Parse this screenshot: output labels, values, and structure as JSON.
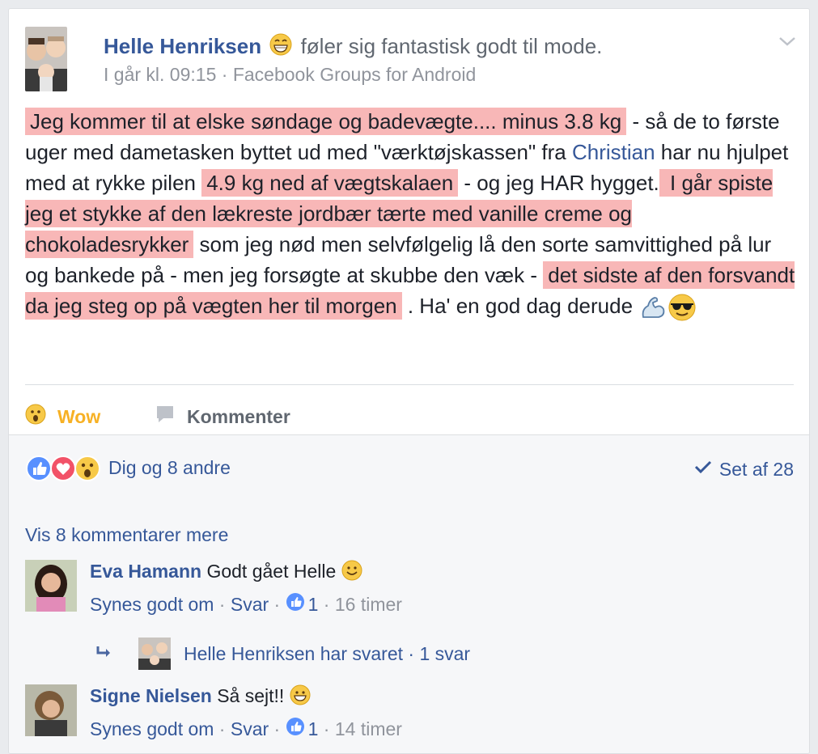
{
  "post": {
    "author": "Helle Henriksen",
    "feeling": "føler sig fantastisk godt til mode.",
    "timestamp": "I går kl. 09:15",
    "separator": " · ",
    "source": "Facebook Groups for Android",
    "body": {
      "hl1": "Jeg kommer til at elske søndage og badevægte....  minus 3.8 kg",
      "t1": " - så de to første uger med dametasken byttet ud med \"værktøjskassen\" fra ",
      "mention": "Christian",
      "t2": " har nu hjulpet med at rykke pilen ",
      "hl2": "4.9 kg ned af vægtskalaen",
      "t3": " - og jeg HAR hygget.",
      "hl3": " I går spiste jeg et stykke af den lækreste jordbær tærte med vanille creme og chokoladesrykker",
      "t4": " som jeg nød men selvfølgelig lå den sorte samvittighed på lur og bankede på - men jeg forsøgte at skubbe den væk - ",
      "hl4": "det sidste af den forsvandt da jeg steg op på vægten her til morgen",
      "t5": " . Ha' en god dag derude "
    }
  },
  "actions": {
    "wow_label": "Wow",
    "comment_label": "Kommenter"
  },
  "feedback": {
    "reactions_text": "Dig og 8 andre",
    "seen_text": "Set af 28",
    "more_comments": "Vis 8 kommentarer mere"
  },
  "comments": [
    {
      "name": "Eva Hamann",
      "text": " Godt gået Helle ",
      "like_label": "Synes godt om",
      "reply_label": "Svar",
      "like_count": "1",
      "time": "16 timer",
      "reply_summary": "Helle Henriksen har svaret · 1 svar"
    },
    {
      "name": "Signe Nielsen",
      "text": " Så sejt!! ",
      "like_label": "Synes godt om",
      "reply_label": "Svar",
      "like_count": "1",
      "time": "14 timer"
    }
  ],
  "colors": {
    "link": "#365899",
    "highlight": "#f8b7b7",
    "wow": "#f7b125",
    "meta": "#90949c"
  },
  "icons": [
    "avatar-photo",
    "grinning-emoji",
    "chevron-down-icon",
    "flexed-biceps-emoji",
    "sunglasses-emoji",
    "wow-icon",
    "comment-icon",
    "like-icon",
    "love-icon",
    "checkmark-icon",
    "smile-emoji",
    "reply-arrow-icon"
  ]
}
